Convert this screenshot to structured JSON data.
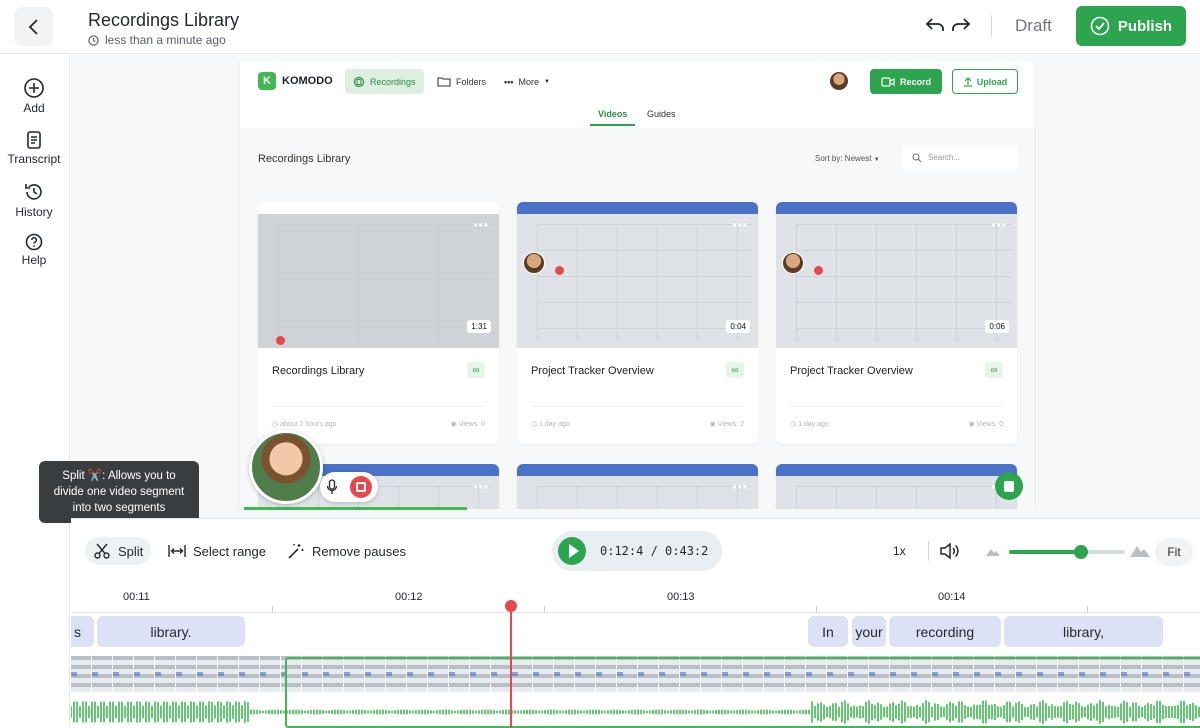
{
  "header": {
    "title": "Recordings Library",
    "subtitle": "less than a minute ago",
    "status": "Draft",
    "publish_label": "Publish"
  },
  "sidebar": {
    "items": [
      {
        "label": "Add",
        "icon": "plus-circle-icon"
      },
      {
        "label": "Transcript",
        "icon": "document-icon"
      },
      {
        "label": "History",
        "icon": "clock-history-icon"
      },
      {
        "label": "Help",
        "icon": "question-circle-icon"
      }
    ]
  },
  "preview": {
    "brand": "KOMODO",
    "nav": {
      "recordings": "Recordings",
      "folders": "Folders",
      "more": "More"
    },
    "record_label": "Record",
    "upload_label": "Upload",
    "tabs": {
      "videos": "Videos",
      "guides": "Guides"
    },
    "library_title": "Recordings Library",
    "sort_label": "Sort by: Newest",
    "search_placeholder": "Search...",
    "cards": [
      {
        "title": "Recordings Library",
        "duration": "1:31",
        "date": "about 2 hours ago",
        "views": "Views: 0"
      },
      {
        "title": "Project Tracker Overview",
        "duration": "0:04",
        "date": "1 day ago",
        "views": "Views: 2"
      },
      {
        "title": "Project Tracker Overview",
        "duration": "0:06",
        "date": "1 day ago",
        "views": "Views: 0"
      }
    ]
  },
  "tooltip": {
    "text": "Split ✂️: Allows you to divide one video segment into two segments"
  },
  "toolbar": {
    "split_label": "Split",
    "select_range_label": "Select range",
    "remove_pauses_label": "Remove pauses",
    "timecode": "0:12:4 / 0:43:2",
    "speed": "1x",
    "fit_label": "Fit",
    "zoom_level": 0.62
  },
  "timeline": {
    "ruler": [
      "00:11",
      "00:12",
      "00:13",
      "00:14"
    ],
    "words": [
      {
        "text": "s"
      },
      {
        "text": "library."
      },
      {
        "text": "In"
      },
      {
        "text": "your"
      },
      {
        "text": "recording"
      },
      {
        "text": "library,"
      }
    ]
  },
  "colors": {
    "accent": "#2da44e",
    "playhead": "#e5484d",
    "word_bg": "#dde1f5"
  }
}
